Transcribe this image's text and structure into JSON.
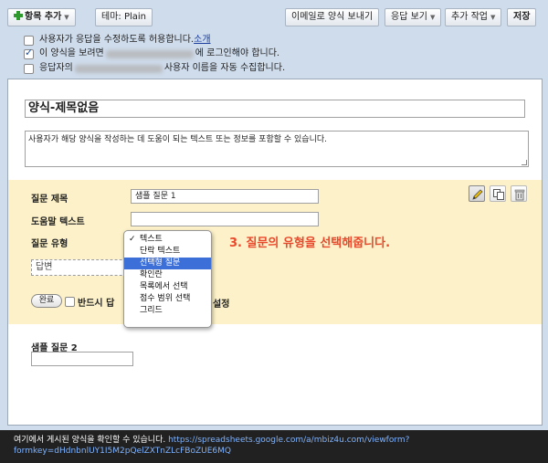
{
  "toolbar": {
    "add_item": "항목 추가",
    "theme": "테마:  Plain",
    "email_form": "이메일로 양식 보내기",
    "view_responses": "응답 보기",
    "more_actions": "추가 작업",
    "save": "저장"
  },
  "settings": {
    "allow_edit": "사용자가 응답을 수정하도록 허용합니다.",
    "allow_edit_link": "소개",
    "allow_edit_checked": false,
    "require_login_prefix": "이 양식을 보려면",
    "require_login_suffix": "에 로그인해야 합니다.",
    "require_login_checked": true,
    "collect_username_prefix": "응답자의",
    "collect_username_suffix": "사용자 이름을 자동 수집합니다.",
    "collect_username_checked": false
  },
  "form": {
    "title": "양식-제목없음",
    "description": "사용자가 해당 양식을 작성하는 데 도움이 되는 텍스트 또는 정보를 포함할 수 있습니다."
  },
  "question": {
    "title_label": "질문 제목",
    "title_value": "샘플 질문 1",
    "help_label": "도움말 텍스트",
    "help_value": "",
    "type_label": "질문 유형",
    "answer_placeholder": "답변",
    "done_button": "완료",
    "required_label": "반드시 답",
    "settings_fragment": "설정",
    "required_checked": false
  },
  "type_dropdown": {
    "checkmark": "✓",
    "options": [
      "텍스트",
      "단락 텍스트",
      "선택형 질문",
      "확인란",
      "목록에서 선택",
      "점수 범위 선택",
      "그리드"
    ],
    "checked_index": 0,
    "highlighted_index": 2
  },
  "annotation": "3. 질문의 유형을 선택해줍니다.",
  "question2": {
    "title": "샘플 질문 2"
  },
  "status_bar": {
    "text": "여기에서 게시된 양식을 확인할 수 있습니다.",
    "url_line1": "https://spreadsheets.google.com/a/mbiz4u.com/viewform?",
    "url_line2": "formkey=dHdnbnlUY1I5M2pQelZXTnZLcFBoZUE6MQ"
  },
  "colors": {
    "annotation": "#e8492c",
    "highlight": "#3d6fd8",
    "question_bg": "#fcf1c8",
    "page_bg": "#cfdcec"
  }
}
